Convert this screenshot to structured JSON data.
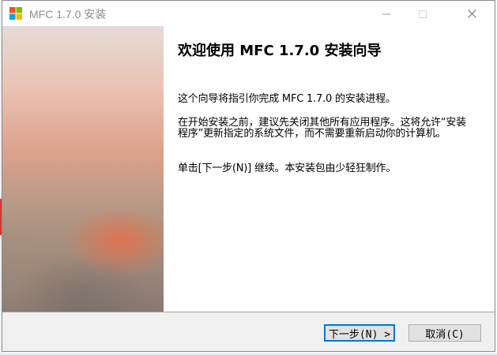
{
  "window": {
    "title": "MFC 1.7.0 安装"
  },
  "content": {
    "heading": "欢迎使用 MFC 1.7.0 安装向导",
    "paragraph_1": "这个向导将指引你完成 MFC 1.7.0 的安装进程。",
    "paragraph_2": "在开始安装之前，建议先关闭其他所有应用程序。这将允许“安装程序”更新指定的系统文件，而不需要重新启动你的计算机。",
    "paragraph_3": "单击[下一步(N)] 继续。本安装包由少轻狂制作。"
  },
  "buttons": {
    "next_label": "下一步(N) >",
    "cancel_label": "取消(C)"
  },
  "icons": {
    "app": "windows-logo-icon",
    "minimize": "minimize-icon",
    "maximize": "maximize-icon",
    "close": "close-icon"
  },
  "colors": {
    "accent": "#0078d7",
    "logo_red": "#f25022",
    "logo_green": "#7fba00",
    "logo_blue": "#00a4ef",
    "logo_yellow": "#ffb900"
  }
}
